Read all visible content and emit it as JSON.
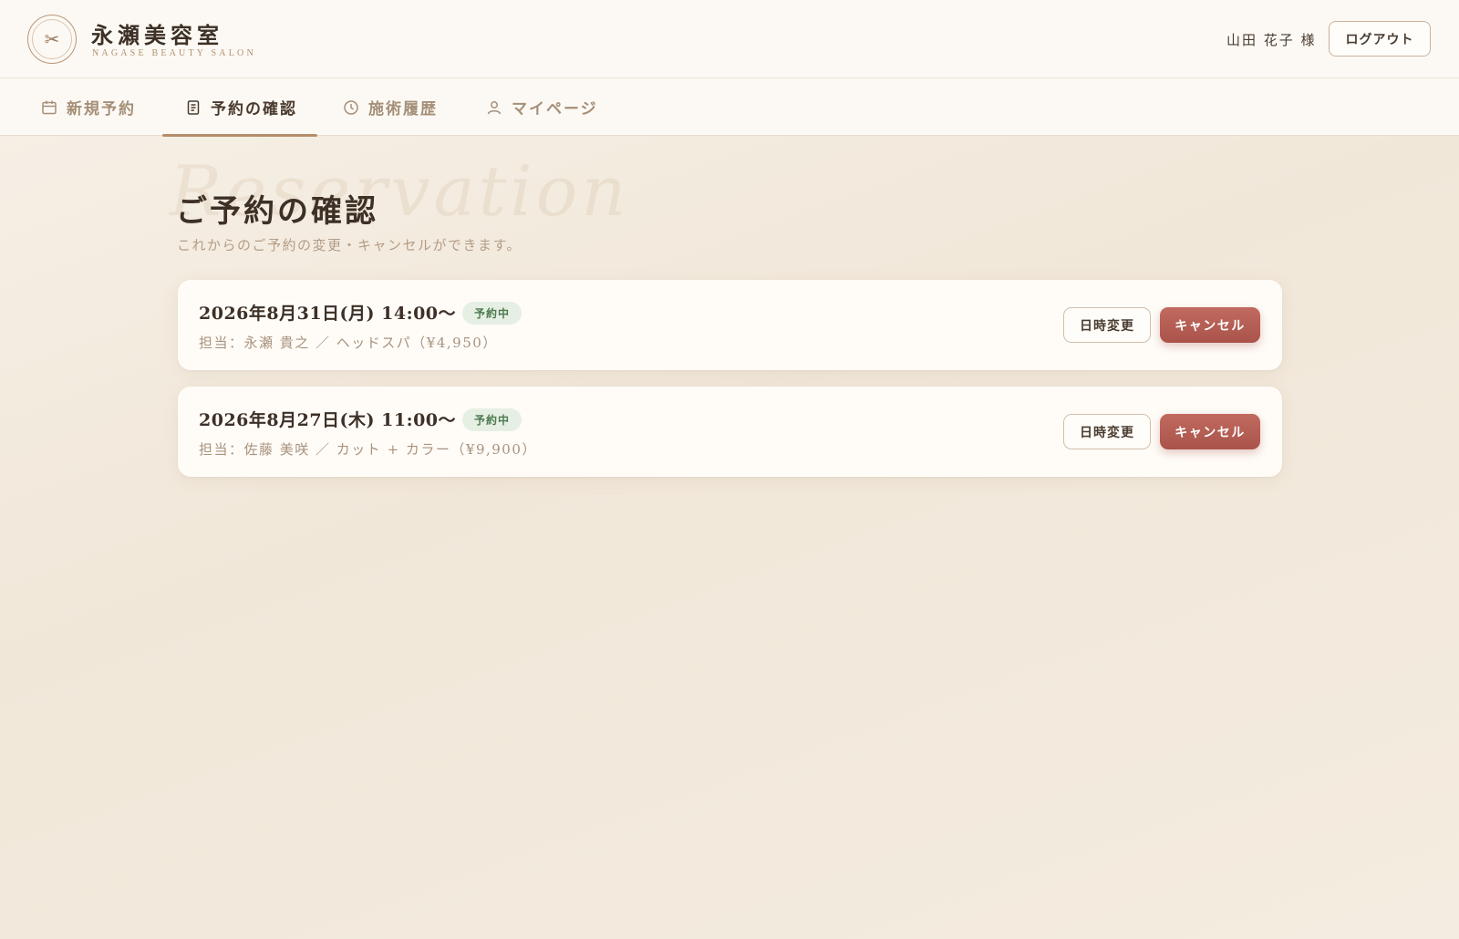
{
  "brand": {
    "name": "永瀬美容室",
    "subtitle": "NAGASE BEAUTY SALON",
    "logo_icon": "scissors-icon"
  },
  "user": {
    "name": "山田 花子 様",
    "logout_label": "ログアウト"
  },
  "nav": {
    "items": [
      {
        "label": "新規予約",
        "icon": "calendar-icon",
        "active": false
      },
      {
        "label": "予約の確認",
        "icon": "document-icon",
        "active": true
      },
      {
        "label": "施術履歴",
        "icon": "clock-icon",
        "active": false
      },
      {
        "label": "マイページ",
        "icon": "user-icon",
        "active": false
      }
    ]
  },
  "page": {
    "watermark": "Reservation",
    "title": "ご予約の確認",
    "description": "これからのご予約の変更・キャンセルができます。"
  },
  "reservations": [
    {
      "date": "2026年8月31日(月) 14:00〜",
      "status": "予約中",
      "meta": "担当：永瀬 貴之 ／ ヘッドスパ（¥4,950）",
      "change_label": "日時変更",
      "cancel_label": "キャンセル"
    },
    {
      "date": "2026年8月27日(木) 11:00〜",
      "status": "予約中",
      "meta": "担当：佐藤 美咲 ／ カット + カラー（¥9,900）",
      "change_label": "日時変更",
      "cancel_label": "キャンセル"
    }
  ],
  "colors": {
    "accent": "#b48f6c",
    "cancel": "#b35c53",
    "status_bg": "#e6efe3",
    "status_text": "#4d7a4f",
    "background": "#f4ece0"
  }
}
